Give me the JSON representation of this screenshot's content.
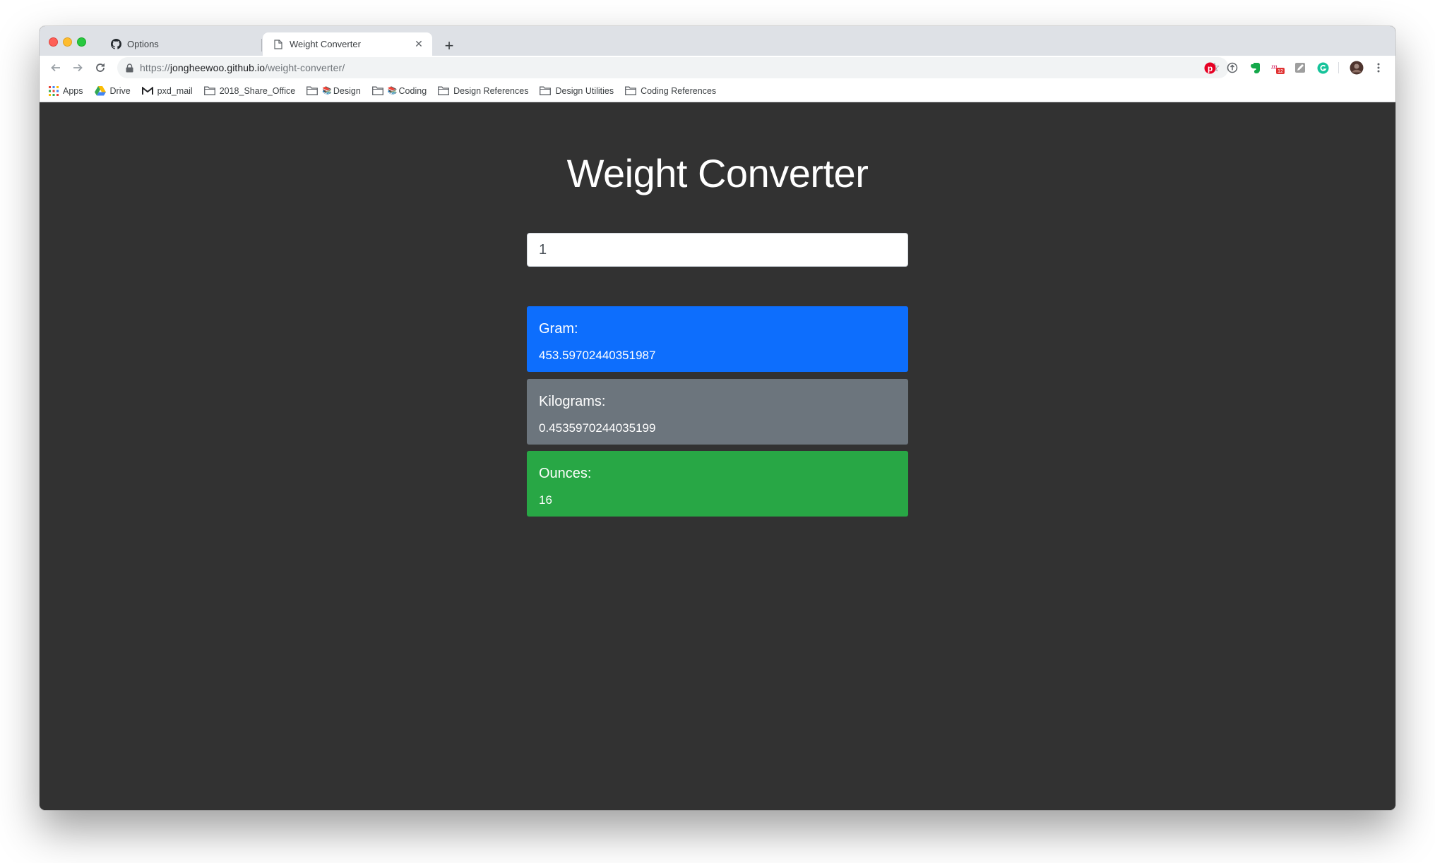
{
  "browser": {
    "tabs": [
      {
        "title": "Options",
        "icon": "github-icon"
      },
      {
        "title": "Weight Converter",
        "icon": "page-icon"
      }
    ],
    "address_bar": {
      "scheme": "https://",
      "host": "jongheewoo.github.io",
      "path": "/weight-converter/"
    },
    "bookmarks": [
      {
        "label": "Apps",
        "icon": "apps-grid-icon"
      },
      {
        "label": "Drive",
        "icon": "drive-icon"
      },
      {
        "label": "pxd_mail",
        "icon": "gmail-icon"
      },
      {
        "label": "2018_Share_Office",
        "icon": "folder-icon"
      },
      {
        "label": "Design",
        "icon": "folder-icon"
      },
      {
        "label": "Coding",
        "icon": "folder-icon"
      },
      {
        "label": "Design References",
        "icon": "folder-icon"
      },
      {
        "label": "Design Utilities",
        "icon": "folder-icon"
      },
      {
        "label": "Coding References",
        "icon": "folder-icon"
      }
    ],
    "extensions": [
      "pinterest-icon",
      "extension-circle-icon",
      "evernote-icon",
      "mail-badge-icon",
      "pen-icon",
      "grammarly-icon",
      "profile-avatar"
    ],
    "extension_badge": "12"
  },
  "page": {
    "title": "Weight Converter",
    "input_value": "1",
    "results": [
      {
        "label": "Gram:",
        "value": "453.59702440351987",
        "color": "#0d6efd"
      },
      {
        "label": "Kilograms:",
        "value": "0.4535970244035199",
        "color": "#6c757d"
      },
      {
        "label": "Ounces:",
        "value": "16",
        "color": "#28a745"
      }
    ]
  }
}
